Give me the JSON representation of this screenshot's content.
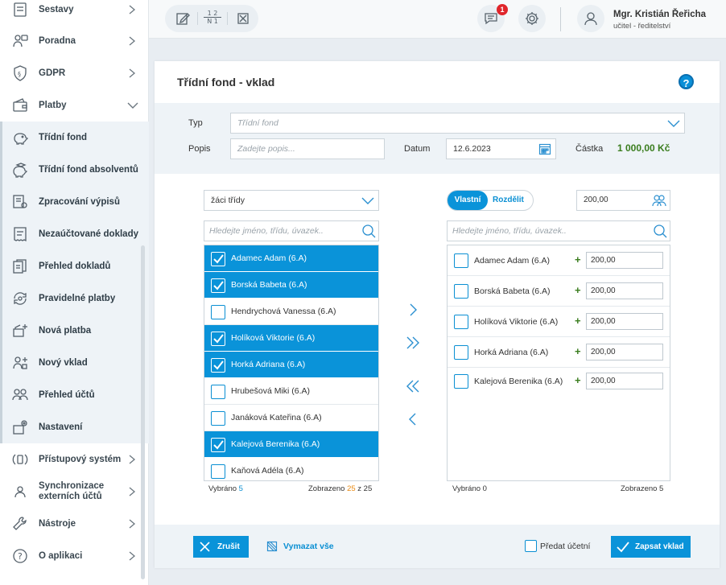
{
  "sidebar": {
    "items": [
      {
        "label": "Sestavy",
        "icon": "report-icon"
      },
      {
        "label": "Poradna",
        "icon": "advice-icon"
      },
      {
        "label": "GDPR",
        "icon": "gdpr-shield-icon"
      },
      {
        "label": "Platby",
        "icon": "wallet-icon"
      }
    ],
    "subitems": [
      {
        "label": "Třídní fond",
        "icon": "piggy-bank-icon"
      },
      {
        "label": "Třídní fond absolventů",
        "icon": "piggy-bank-grad-icon"
      },
      {
        "label": "Zpracování výpisů",
        "icon": "statement-icon"
      },
      {
        "label": "Nezaúčtované doklady",
        "icon": "receipt-icon"
      },
      {
        "label": "Přehled dokladů",
        "icon": "documents-overview-icon"
      },
      {
        "label": "Pravidelné platby",
        "icon": "recurring-payment-icon"
      },
      {
        "label": "Nová platba",
        "icon": "new-payment-icon"
      },
      {
        "label": "Nový vklad",
        "icon": "new-deposit-icon"
      },
      {
        "label": "Přehled účtů",
        "icon": "accounts-overview-icon"
      },
      {
        "label": "Nastavení",
        "icon": "settings-icon"
      }
    ],
    "bottom_items": [
      {
        "label": "Přístupový systém",
        "icon": "access-system-icon"
      },
      {
        "label": "Synchronizace externích účtů",
        "icon": "sync-accounts-icon"
      },
      {
        "label": "Nástroje",
        "icon": "tools-icon"
      },
      {
        "label": "O aplikaci",
        "icon": "about-icon"
      }
    ]
  },
  "topbar": {
    "tools": [
      "edit-icon",
      "numbering-icon",
      "close-box-icon"
    ],
    "tool_numbering_top": "1 2",
    "tool_numbering_bottom": "N 1",
    "notifications_count": "1",
    "user_name": "Mgr. Kristián Řeřicha",
    "user_role": "učitel - ředitelství"
  },
  "form": {
    "title": "Třídní fond - vklad",
    "help": "?",
    "type_label": "Typ",
    "type_placeholder": "Třídní fond",
    "desc_label": "Popis",
    "desc_placeholder": "Zadejte popis...",
    "date_label": "Datum",
    "date_value": "12.6.2023",
    "amount_label": "Částka",
    "amount_value": "1 000,00 Kč"
  },
  "left_panel": {
    "filter": "žáci třídy",
    "search_placeholder": "Hledejte jméno, třídu, úvazek..",
    "students": [
      {
        "name": "Adamec Adam (6.A)",
        "selected": true
      },
      {
        "name": "Borská Babeta (6.A)",
        "selected": true
      },
      {
        "name": "Hendrychová Vanessa (6.A)",
        "selected": false
      },
      {
        "name": "Holíková Viktorie (6.A)",
        "selected": true
      },
      {
        "name": "Horká Adriana (6.A)",
        "selected": true
      },
      {
        "name": "Hrubešová Miki (6.A)",
        "selected": false
      },
      {
        "name": "Janáková Kateřina (6.A)",
        "selected": false
      },
      {
        "name": "Kalejová Berenika (6.A)",
        "selected": true
      },
      {
        "name": "Kaňová Adéla (6.A)",
        "selected": false
      }
    ],
    "selected_label": "Vybráno",
    "selected_count": "5",
    "shown_label": "Zobrazeno",
    "shown_count": "25",
    "shown_of": "z 25"
  },
  "right_panel": {
    "toggle_own": "Vlastní",
    "toggle_split": "Rozdělit",
    "bulk_amount": "200,00",
    "search_placeholder": "Hledejte jméno, třídu, úvazek..",
    "rows": [
      {
        "name": "Adamec Adam (6.A)",
        "amount": "200,00"
      },
      {
        "name": "Borská Babeta (6.A)",
        "amount": "200,00"
      },
      {
        "name": "Holíková Viktorie (6.A)",
        "amount": "200,00"
      },
      {
        "name": "Horká Adriana (6.A)",
        "amount": "200,00"
      },
      {
        "name": "Kalejová Berenika (6.A)",
        "amount": "200,00"
      }
    ],
    "plus": "+",
    "selected_label": "Vybráno 0",
    "shown_label": "Zobrazeno 5"
  },
  "actions": {
    "cancel": "Zrušit",
    "clear_all": "Vymazat vše",
    "pass_accountant": "Předat účetní",
    "submit": "Zapsat vklad"
  },
  "colors": {
    "accent": "#0a93d9",
    "amount_green": "#3a7d1e",
    "badge_red": "#e0262b"
  }
}
